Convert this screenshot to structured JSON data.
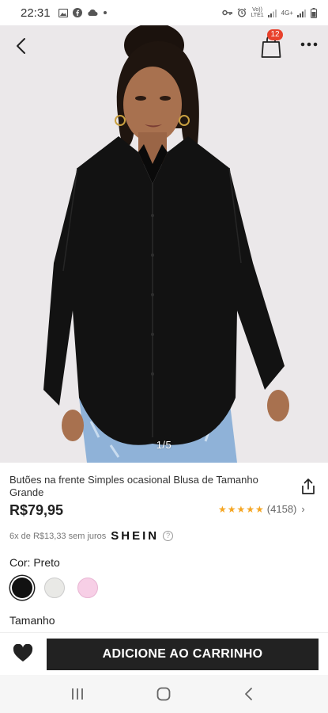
{
  "status_bar": {
    "time": "22:31",
    "left_icons": [
      "image-icon",
      "facebook-icon",
      "cloud-icon",
      "dot-icon"
    ],
    "right_icons": [
      "key-icon",
      "alarm-icon",
      "volte-icon",
      "signal-icon",
      "4g-icon",
      "signal-icon",
      "battery-icon"
    ],
    "volte_label": "Vo))\nLTE1",
    "network_label": "4G+"
  },
  "header": {
    "back_icon": "chevron-left-icon",
    "bag_icon": "shopping-bag-icon",
    "bag_count": "12",
    "more_icon": "more-horizontal-icon"
  },
  "gallery": {
    "counter": "1/5",
    "current": 1,
    "total": 5
  },
  "product": {
    "title": "Butões na frente Simples ocasional Blusa de Tamanho Grande",
    "price": "R$79,95",
    "rating_stars": 4.5,
    "review_count": "(4158)",
    "installment_text": "6x de R$13,33 sem juros",
    "brand": "SHEIN",
    "color_label": "Cor: Preto",
    "colors": [
      {
        "name": "Preto",
        "hex": "#111111",
        "selected": true
      },
      {
        "name": "Off-white",
        "hex": "#e9e9e6",
        "selected": false
      },
      {
        "name": "Rosa",
        "hex": "#f7cfe6",
        "selected": false
      }
    ],
    "size_label": "Tamanho"
  },
  "actions": {
    "wishlist_icon": "heart-icon",
    "add_to_cart": "ADICIONE AO CARRINHO"
  },
  "android_nav": {
    "icons": [
      "recent-apps-icon",
      "home-icon",
      "back-icon"
    ]
  },
  "theme": {
    "accent": "#222222",
    "badge": "#e8412c",
    "star": "#f5a623"
  }
}
